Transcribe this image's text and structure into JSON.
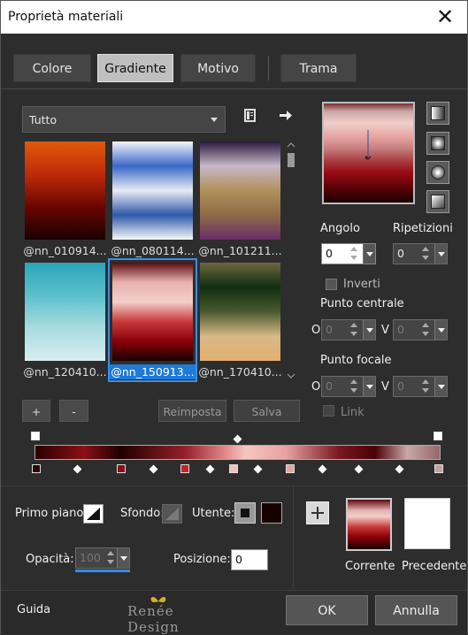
{
  "window": {
    "title": "Proprietà materiali",
    "close": "✕"
  },
  "tabs": [
    {
      "label": "Colore",
      "active": false
    },
    {
      "label": "Gradiente",
      "active": true
    },
    {
      "label": "Motivo",
      "active": false
    },
    {
      "label": "Trama",
      "active": false
    }
  ],
  "category": {
    "value": "Tutto"
  },
  "gradients": [
    {
      "name": "@nn_010914...",
      "colors": [
        "#e05a0a",
        "#bf2a08",
        "#6a0600",
        "#1a0000"
      ]
    },
    {
      "name": "@nn_080114...",
      "colors": [
        "#f2f4fa",
        "#3a68c8",
        "#e8eaf4",
        "#2e58a8",
        "#f8f8fc"
      ]
    },
    {
      "name": "@nn_101211...",
      "colors": [
        "#2a1a40",
        "#c8b8c8",
        "#b0905a",
        "#8e6a48",
        "#6a2e6a"
      ]
    },
    {
      "name": "@nn_120410...",
      "colors": [
        "#2aa6b8",
        "#5cc0cc",
        "#a8dce0",
        "#d8eef0"
      ]
    },
    {
      "name": "@nn_150913...",
      "colors": [
        "#5a0a10",
        "#e8b2b0",
        "#f2cfc8",
        "#c83a3c",
        "#8a0008",
        "#1a0000"
      ],
      "selected": true
    },
    {
      "name": "@nn_170410...",
      "colors": [
        "#6e6640",
        "#0e2e12",
        "#4a5a30",
        "#d8b888",
        "#e2b070"
      ]
    }
  ],
  "buttons": {
    "add": "+",
    "remove": "-",
    "reset": "Reimposta",
    "save": "Salva"
  },
  "settings": {
    "angle_label": "Angolo",
    "angle": "0",
    "repeats_label": "Ripetizioni",
    "repeats": "0",
    "invert_label": "Inverti",
    "center_label": "Punto centrale",
    "center_h": "O",
    "center_h_val": "0",
    "center_v": "V",
    "center_v_val": "0",
    "focal_label": "Punto focale",
    "focal_h": "O",
    "focal_h_val": "0",
    "focal_v": "V",
    "focal_v_val": "0",
    "link_label": "Link"
  },
  "gradient_bar": {
    "stops": [
      {
        "pos": 0.0,
        "color": "#2a0000"
      },
      {
        "pos": 0.21,
        "color": "#8a1018"
      },
      {
        "pos": 0.37,
        "color": "#c82028"
      },
      {
        "pos": 0.49,
        "color": "#f2c2ba"
      },
      {
        "pos": 0.63,
        "color": "#e6a2a0"
      },
      {
        "pos": 1.0,
        "color": "#c8a0a0"
      }
    ],
    "midpoints": [
      0.1,
      0.29,
      0.43,
      0.55,
      0.71,
      0.8,
      0.9
    ]
  },
  "bottom": {
    "foreground_label": "Primo piano:",
    "background_label": "Sfondo:",
    "user_label": "Utente:",
    "opacity_label": "Opacità:",
    "opacity": "100",
    "position_label": "Posizione:",
    "position": "0",
    "current_label": "Corrente",
    "previous_label": "Precedente"
  },
  "footer": {
    "help": "Guida",
    "logo": "Renée Design",
    "ok": "OK",
    "cancel": "Annulla"
  }
}
